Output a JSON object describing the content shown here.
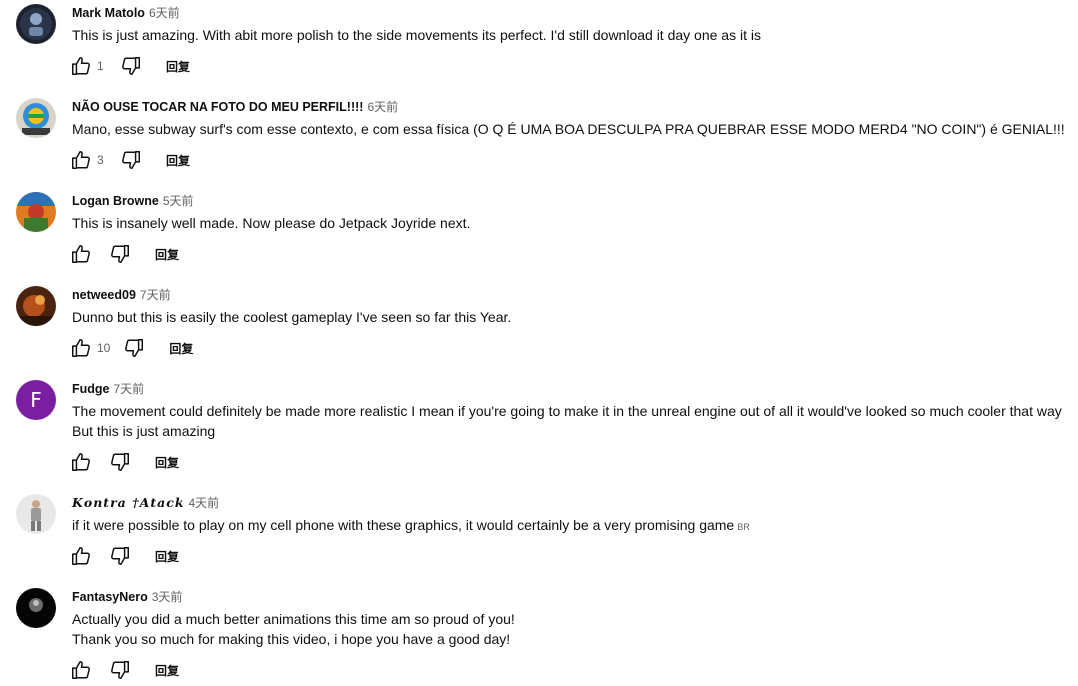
{
  "comments": [
    {
      "author": "Mark Matolo",
      "time": "6天前",
      "text": "This is just amazing. With abit more polish to the side movements its perfect. I'd still download it day one as it is",
      "likes": "1",
      "reply_label": "回复"
    },
    {
      "author": "NÃO OUSE TOCAR NA FOTO DO MEU PERFIL!!!!",
      "time": "6天前",
      "text": "Mano, esse subway surf's com esse contexto, e com essa física (O Q É UMA BOA DESCULPA PRA QUEBRAR ESSE MODO MERD4 \"NO COIN\") é GENIAL!!!",
      "likes": "3",
      "reply_label": "回复"
    },
    {
      "author": "Logan Browne",
      "time": "5天前",
      "text": "This is insanely well made. Now please do Jetpack Joyride next.",
      "likes": "",
      "reply_label": "回复"
    },
    {
      "author": "netweed09",
      "time": "7天前",
      "text": "Dunno but this is easily the coolest gameplay I've seen so far this Year.",
      "likes": "10",
      "reply_label": "回复"
    },
    {
      "author": "Fudge",
      "time": "7天前",
      "avatar_letter": "F",
      "text_line1": "The movement could definitely be made more realistic I mean if you're going to make it in the unreal engine out of all it would've looked so much cooler that way",
      "text_line2": "But this is just amazing",
      "likes": "",
      "reply_label": "回复"
    },
    {
      "author": "𝑲𝒐𝒏𝒕𝒓𝒂 †𝑨𝒕𝒂𝒄𝒌",
      "time": "4天前",
      "text": "if it were possible to play on my cell phone with these graphics, it would certainly be a very promising game",
      "flag": "BR",
      "likes": "",
      "reply_label": "回复"
    },
    {
      "author": "FantasyNero",
      "time": "3天前",
      "text_line1": "Actually you did a much better animations this time am so proud of you!",
      "text_line2": "Thank you so much for making this video, i hope you have a good day!",
      "likes": "",
      "reply_label": "回复"
    }
  ],
  "colors": {
    "text_primary": "#0f0f0f",
    "text_secondary": "#606060",
    "fudge_avatar": "#7b1fa2"
  },
  "icons": {
    "like": "thumbs-up-icon",
    "dislike": "thumbs-down-icon"
  }
}
